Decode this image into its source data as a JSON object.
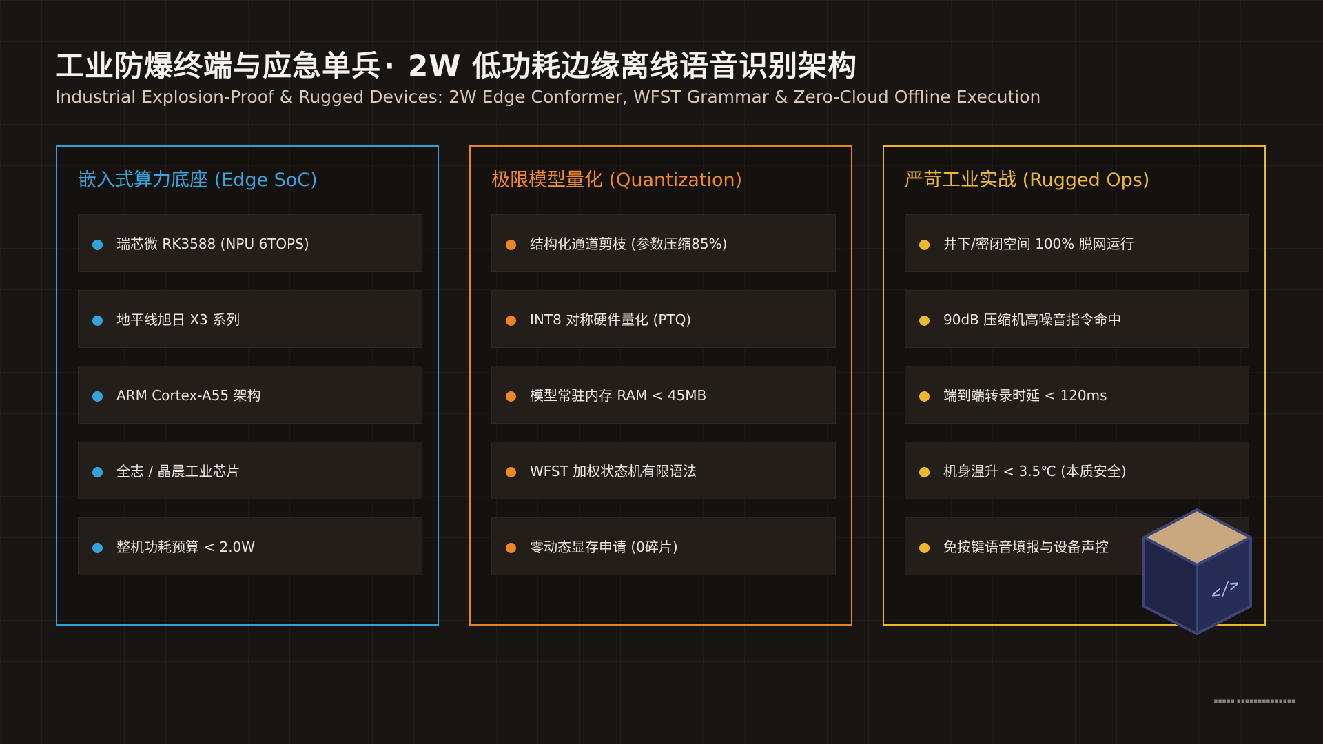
{
  "header": {
    "title_main": "工业防爆终端与应急单兵",
    "title_sep": "·",
    "title_sub": "2W 低功耗边缘离线语音识别架构",
    "subtitle": "Industrial Explosion-Proof & Rugged Devices: 2W Edge Conformer, WFST Grammar & Zero-Cloud Offline Execution"
  },
  "panels": [
    {
      "title": "嵌入式算力底座 (Edge SoC)",
      "accent": "#2f9fd8",
      "items": [
        "瑞芯微 RK3588 (NPU 6TOPS)",
        "地平线旭日 X3 系列",
        "ARM Cortex-A55 架构",
        "全志 / 晶晨工业芯片",
        "整机功耗预算 < 2.0W"
      ]
    },
    {
      "title": "极限模型量化 (Quantization)",
      "accent": "#e98426",
      "items": [
        "结构化通道剪枝 (参数压缩85%)",
        "INT8 对称硬件量化 (PTQ)",
        "模型常驻内存 RAM < 45MB",
        "WFST 加权状态机有限语法",
        "零动态显存申请 (0碎片)"
      ]
    },
    {
      "title": "严苛工业实战 (Rugged Ops)",
      "accent": "#e9b62c",
      "items": [
        "井下/密闭空间 100% 脱网运行",
        "90dB 压缩机高噪音指令命中",
        "端到端转录时延 < 120ms",
        "机身温升 < 3.5℃ (本质安全)",
        "免按键语音填报与设备声控"
      ]
    }
  ],
  "cube_icon": {
    "name": "code-cube-icon",
    "glyph": "</>"
  },
  "footnote": "▪▪▪▪▪ ▪▪▪▪▪▪▪▪▪▪▪▪▪▪"
}
